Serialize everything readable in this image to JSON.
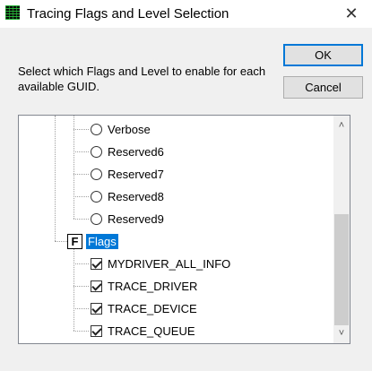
{
  "window": {
    "title": "Tracing Flags and Level Selection",
    "close_glyph": "✕",
    "icon": "trace-app-icon"
  },
  "instructions": "Select which Flags and Level to enable for each available GUID.",
  "buttons": {
    "ok_label": "OK",
    "cancel_label": "Cancel"
  },
  "tree": {
    "levels": [
      {
        "label": "Verbose",
        "selected": false
      },
      {
        "label": "Reserved6",
        "selected": false
      },
      {
        "label": "Reserved7",
        "selected": false
      },
      {
        "label": "Reserved8",
        "selected": false
      },
      {
        "label": "Reserved9",
        "selected": false
      }
    ],
    "flags_node": {
      "icon_glyph": "F",
      "label": "Flags"
    },
    "flags": [
      {
        "label": "MYDRIVER_ALL_INFO",
        "checked": true
      },
      {
        "label": "TRACE_DRIVER",
        "checked": true
      },
      {
        "label": "TRACE_DEVICE",
        "checked": true
      },
      {
        "label": "TRACE_QUEUE",
        "checked": true
      }
    ]
  },
  "scrollbar": {
    "up_glyph": "˄",
    "down_glyph": "˅"
  },
  "colors": {
    "selection": "#0078d7",
    "default_button_border": "#0078d7"
  }
}
